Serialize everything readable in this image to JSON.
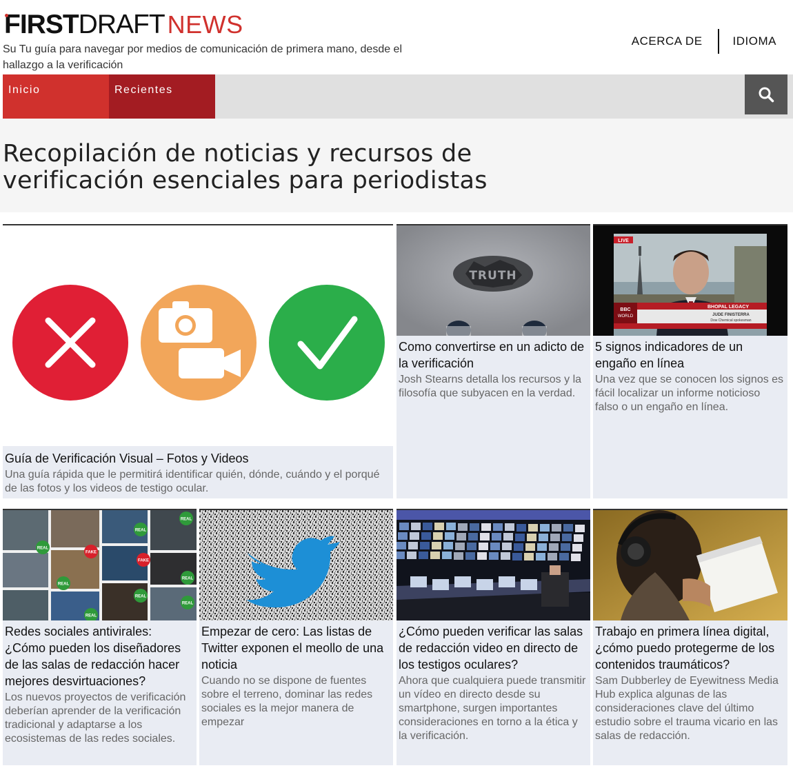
{
  "header": {
    "logo_first": "FIRST",
    "logo_draft": "DRAFT",
    "logo_news": "NEWS",
    "tagline": "Su Tu guía para navegar por medios de comunicación de primera mano, desde el hallazgo a la verificación"
  },
  "topnav": {
    "about": "ACERCA DE",
    "language": "IDIOMA"
  },
  "nav": {
    "tabs": [
      {
        "label": "Inicio"
      },
      {
        "label": "Recientes"
      }
    ]
  },
  "hero": {
    "title": "Recopilación de noticias y recursos de verificación esenciales para periodistas"
  },
  "cards": [
    {
      "title": "Guía de Verificación Visual – Fotos y Videos",
      "desc": "Una guía rápida que le permitirá identificar quién, dónde, cuándo y el porqué de las fotos y los videos de testigo ocular.",
      "image": "verification-icons"
    },
    {
      "title": "Como convertirse en un adicto de la verificación",
      "desc": "Josh Stearns detalla los recursos y la filosofía que subyacen en la verdad.",
      "image": "truth-stencil-photo"
    },
    {
      "title": "5 signos indicadores de un engaño en línea",
      "desc": "Una vez que se conocen los signos es fácil localizar un informe noticioso falso o un engaño en línea.",
      "image": "bbc-news-broadcast-photo"
    },
    {
      "title": "Redes sociales antivirales: ¿Cómo pueden los diseñadores de las salas de redacción hacer mejores desvirtuaciones?",
      "desc": "Los nuevos proyectos de verificación deberían aprender de la verificación tradicional y adaptarse a los ecosistemas de las redes sociales.",
      "image": "real-fake-photo-collage"
    },
    {
      "title": "Empezar de cero: Las listas de Twitter exponen el meollo de una noticia",
      "desc": "Cuando no se dispone de fuentes sobre el terreno, dominar las redes sociales es la mejor manera de empezar",
      "image": "twitter-bird-static"
    },
    {
      "title": "¿Cómo pueden verificar las salas de redacción video en directo de los testigos oculares?",
      "desc": "Ahora que cualquiera puede transmitir un vídeo en directo desde su smartphone, surgen importantes consideraciones en torno a la ética y la verificación.",
      "image": "newsroom-control-room-photo"
    },
    {
      "title": "Trabajo en primera línea digital, ¿cómo puedo protegerme de los contenidos traumáticos?",
      "desc": "Sam Dubberley de Eyewitness Media Hub explica algunas de las consideraciones clave del último estudio sobre el trauma vicario en las salas de redacción.",
      "image": "person-headphones-tablet-photo"
    }
  ],
  "collage_badges": [
    "REAL",
    "FAKE",
    "REAL",
    "REAL",
    "FAKE",
    "REAL",
    "REAL",
    "REAL",
    "REAL",
    "REAL"
  ],
  "truth_text": "TRUTH",
  "tv": {
    "live": "LIVE",
    "bbc": "BBC",
    "world": "WORLD",
    "name": "JUDE FINISTERRA",
    "role": "Dow Chemical spokesman",
    "strap": "BHOPAL LEGACY"
  },
  "colors": {
    "brand_red": "#d0312d",
    "dark_red": "#a31c22",
    "card_bg": "#e9ecf3",
    "x_red": "#e01f35",
    "camera_orange": "#f2a65a",
    "check_green": "#2bae4a"
  }
}
